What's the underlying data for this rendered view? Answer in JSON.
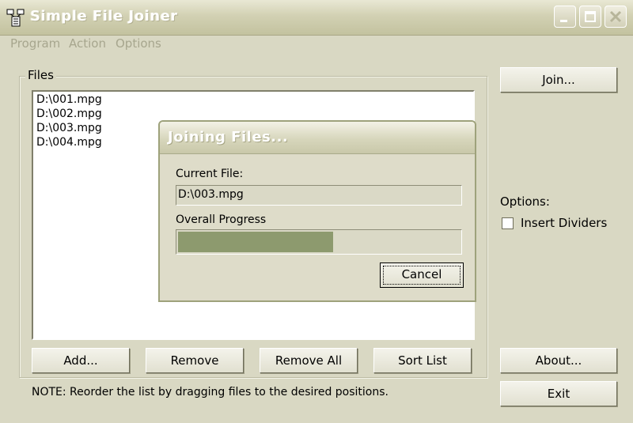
{
  "window": {
    "title": "Simple File Joiner"
  },
  "menu": {
    "items": [
      "Program",
      "Action",
      "Options"
    ]
  },
  "files": {
    "group_label": "Files",
    "items": [
      "D:\\001.mpg",
      "D:\\002.mpg",
      "D:\\003.mpg",
      "D:\\004.mpg"
    ]
  },
  "buttons": {
    "add": "Add...",
    "remove": "Remove",
    "remove_all": "Remove All",
    "sort_list": "Sort List",
    "join": "Join...",
    "about": "About...",
    "exit": "Exit"
  },
  "note": "NOTE: Reorder the list by dragging files to the desired positions.",
  "options": {
    "label": "Options:",
    "insert_dividers": "Insert Dividers",
    "insert_dividers_checked": false
  },
  "dialog": {
    "title": "Joining Files...",
    "current_file_label": "Current File:",
    "current_file": "D:\\003.mpg",
    "progress_label": "Overall Progress",
    "progress_percent": 55,
    "cancel": "Cancel"
  },
  "colors": {
    "progress": "#8d9a6e",
    "titlebar": "#d2d1b3"
  }
}
